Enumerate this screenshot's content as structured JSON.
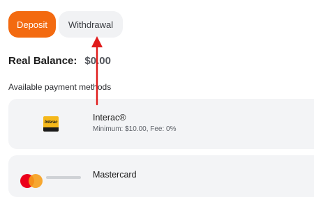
{
  "tabs": {
    "deposit_label": "Deposit",
    "withdrawal_label": "Withdrawal"
  },
  "balance": {
    "label": "Real Balance:",
    "value": "$0.00"
  },
  "section_title": "Available payment methods",
  "methods": [
    {
      "name": "Interac®",
      "details": "Minimum: $10.00, Fee: 0%",
      "icon": "interac-logo-icon",
      "logo_text": "Interac"
    },
    {
      "name": "Mastercard",
      "icon": "mastercard-logo-icon"
    }
  ],
  "colors": {
    "accent": "#f36a10",
    "tab_inactive": "#f1f2f4",
    "card_bg": "#f3f4f6",
    "arrow": "#e01b1b",
    "mastercard_red": "#eb001b",
    "mastercard_yellow": "#f79e1b"
  }
}
